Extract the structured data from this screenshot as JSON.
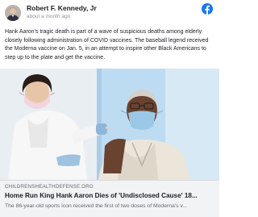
{
  "post": {
    "author": "Robert F. Kennedy, Jr",
    "timestamp": "about a month ago",
    "text": "Hank Aaron's tragic death is part of a wave of suspicious deaths among elderly closely following administration of COVID vaccines. The baseball legend received the Moderna vaccine on Jan. 5, in an attempt to inspire other Black Americans to step up to the plate and get the vaccine.",
    "platform_icon": "facebook-icon",
    "brand_color": "#1877f2"
  },
  "link_preview": {
    "domain": "CHILDRENSHEALTHDEFENSE.ORG",
    "title": "Home Run King Hank Aaron Dies of 'Undisclosed Cause' 18...",
    "description": "The 86-year-old sports icon received the first of two doses of Moderna's v..."
  }
}
